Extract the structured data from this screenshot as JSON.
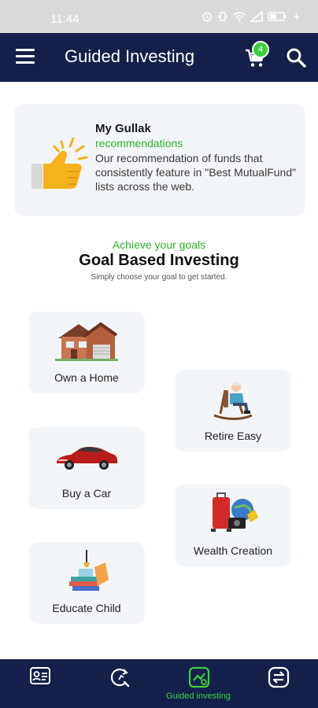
{
  "status_bar": {
    "time": "11:44"
  },
  "app_bar": {
    "title": "Guided Investing",
    "cart_count": "4"
  },
  "recommendation": {
    "title": "My Gullak",
    "subtitle": "recommendations",
    "description": "Our recommendation of funds that consistently feature in \"Best MutualFund\" lists across the web."
  },
  "goals_section": {
    "kicker": "Achieve your goals",
    "title": "Goal Based Investing",
    "hint": "Simply choose your goal to get started."
  },
  "goals": [
    {
      "label": "Own a Home"
    },
    {
      "label": "Retire Easy"
    },
    {
      "label": "Buy a Car"
    },
    {
      "label": "Wealth Creation"
    },
    {
      "label": "Educate Child"
    }
  ],
  "bottom_nav": {
    "items": [
      {
        "icon": "profile-card-icon",
        "label": ""
      },
      {
        "icon": "refresh-search-icon",
        "label": ""
      },
      {
        "icon": "guided-investing-icon",
        "label": "Guided investing"
      },
      {
        "icon": "transfer-icon",
        "label": ""
      }
    ]
  },
  "colors": {
    "navy": "#14204a",
    "green": "#2ab52a",
    "card": "#f3f6f8"
  }
}
